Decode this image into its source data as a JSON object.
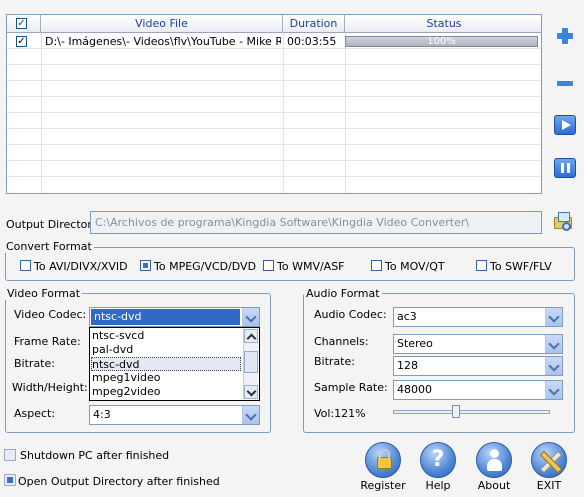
{
  "file_table": {
    "headers": {
      "check": "✓",
      "video_file": "Video File",
      "duration": "Duration",
      "status": "Status"
    },
    "rows": [
      {
        "checked": "✓",
        "file": "D:\\- Imágenes\\- Videos\\flv\\YouTube - Mike Relm",
        "duration": "00:03:55",
        "status": "100%",
        "progress_percent": 100
      }
    ]
  },
  "side_buttons": {
    "add": "plus-icon",
    "remove": "minus-icon",
    "start": "play-icon",
    "pause": "pause-icon"
  },
  "output": {
    "label": "Output Directory",
    "path": "C:\\Archivos de programa\\Kingdia Software\\Kingdia Video Converter\\",
    "browse_icon": "folder-icon"
  },
  "convert_format": {
    "legend": "Convert Format",
    "options": [
      "To AVI/DIVX/XVID",
      "To MPEG/VCD/DVD",
      "To WMV/ASF",
      "To MOV/QT",
      "To SWF/FLV"
    ],
    "selected": "To MPEG/VCD/DVD"
  },
  "video_format": {
    "legend": "Video Format",
    "codec_label": "Video Codec:",
    "codec_value": "ntsc-dvd",
    "frame_rate_label": "Frame Rate:",
    "bitrate_label": "Bitrate:",
    "size_label": "Width/Height:",
    "aspect_label": "Aspect:",
    "aspect_value": "4:3",
    "dropdown_options": [
      "ntsc-svcd",
      "pal-dvd",
      "ntsc-dvd",
      "mpeg1video",
      "mpeg2video"
    ],
    "dropdown_selected": "ntsc-dvd"
  },
  "audio_format": {
    "legend": "Audio Format",
    "codec_label": "Audio Codec:",
    "codec_value": "ac3",
    "channels_label": "Channels:",
    "channels_value": "Stereo",
    "bitrate_label": "Bitrate:",
    "bitrate_value": "128",
    "sample_rate_label": "Sample Rate:",
    "sample_rate_value": "48000",
    "volume_label": "Vol:121%",
    "volume_level": 0.4
  },
  "options": {
    "shutdown_label": "Shutdown PC after finished",
    "shutdown_checked": false,
    "open_dir_label": "Open Output Directory after finished",
    "open_dir_checked": true
  },
  "bottom_buttons": {
    "register": "Register",
    "help": "Help",
    "about": "About",
    "exit": "EXIT"
  },
  "colors": {
    "header_text": "#1f3f9e",
    "accent_blue": "#3a84d9",
    "border": "#7f9db9",
    "selection": "#3169c6"
  }
}
